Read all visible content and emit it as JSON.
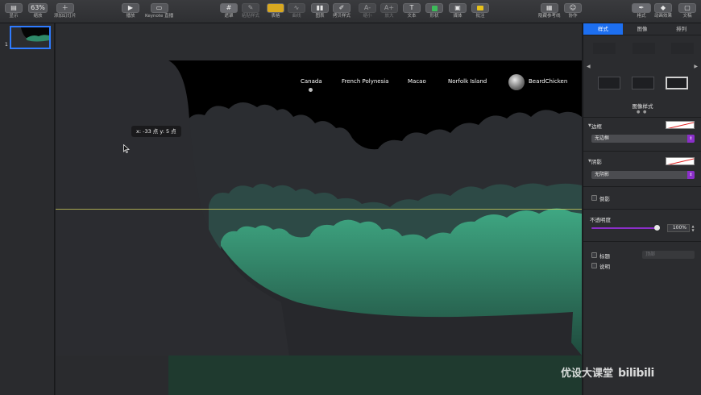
{
  "toolbar": {
    "display_label": "显示",
    "zoom_value": "63%",
    "zoom_label": "缩放",
    "add_slide_label": "添加幻灯片",
    "play_label": "播放",
    "keynote_live_label": "Keynote 直播",
    "mask_label": "遮罩",
    "copy_style_label": "粘贴样式",
    "table_label": "表格",
    "curve_label": "曲线",
    "chart_label": "图表",
    "copy_shape_style_label": "拷贝样式",
    "shrink_label": "缩小",
    "enlarge_label": "放大",
    "text_label": "文本",
    "shape_label": "形状",
    "media_label": "媒体",
    "comment_label": "批注",
    "hide_guides_label": "隐藏参考线",
    "collaborate_label": "协作",
    "format_label": "格式",
    "animate_label": "动画效果",
    "document_label": "文稿"
  },
  "navigator": {
    "slide_number": "1"
  },
  "slide": {
    "nav_items": [
      "Canada",
      "French Polynesia",
      "Macao",
      "Norfolk Island"
    ],
    "brand": "BeardChicken",
    "tooltip": "x: -33 点  y: 5 点"
  },
  "inspector": {
    "tabs": [
      "样式",
      "图像",
      "排列"
    ],
    "image_style_label": "图像样式",
    "border_label": "边框",
    "border_value": "无边框",
    "shadow_label": "阴影",
    "shadow_value": "无阴影",
    "reflection_label": "倒影",
    "opacity_label": "不透明度",
    "opacity_value": "100%",
    "opacity_fraction": 1.0,
    "title_label": "标题",
    "caption_label": "说明",
    "title_position": "顶部"
  },
  "watermark": {
    "text": "优设大课堂",
    "logo": "bilibili"
  },
  "colors": {
    "accent": "#1d6ff0",
    "slider": "#8b2fc9",
    "green_light": "#3fa883",
    "green_dark": "#1f4a3d"
  }
}
